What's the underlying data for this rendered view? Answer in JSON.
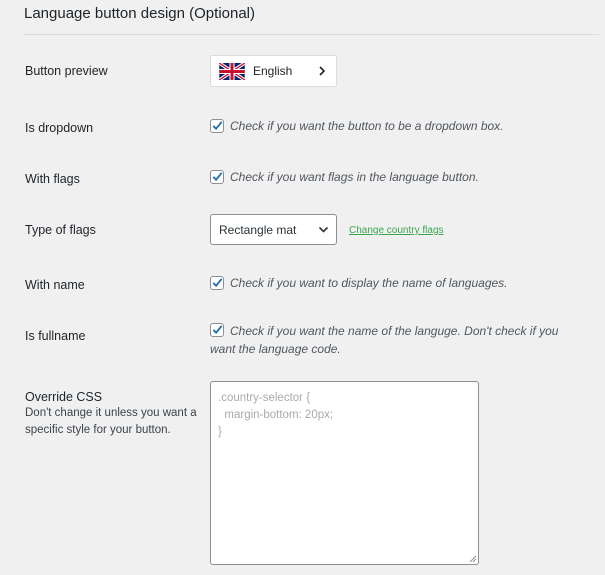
{
  "section": {
    "title": "Language button design (Optional)"
  },
  "button_preview": {
    "label": "Button preview",
    "language": "English",
    "flag_icon": "uk-flag-icon",
    "arrow_icon": "chevron-right-icon"
  },
  "is_dropdown": {
    "label": "Is dropdown",
    "checked": true,
    "description": "Check if you want the button to be a dropdown box."
  },
  "with_flags": {
    "label": "With flags",
    "checked": true,
    "description": "Check if you want flags in the language button."
  },
  "type_of_flags": {
    "label": "Type of flags",
    "selected": "Rectangle mat",
    "link_text": "Change country flags"
  },
  "with_name": {
    "label": "With name",
    "checked": true,
    "description": "Check if you want to display the name of languages."
  },
  "is_fullname": {
    "label": "Is fullname",
    "checked": true,
    "description": "Check if you want the name of the languge. Don't check if you want the language code."
  },
  "override_css": {
    "label": "Override CSS",
    "description": "Don't change it unless you want a specific style for your button.",
    "placeholder": ".country-selector {\n  margin-bottom: 20px;\n}"
  },
  "colors": {
    "background": "#f0f0f1",
    "checkbox_check": "#2271b1",
    "link": "#3ca64e"
  }
}
